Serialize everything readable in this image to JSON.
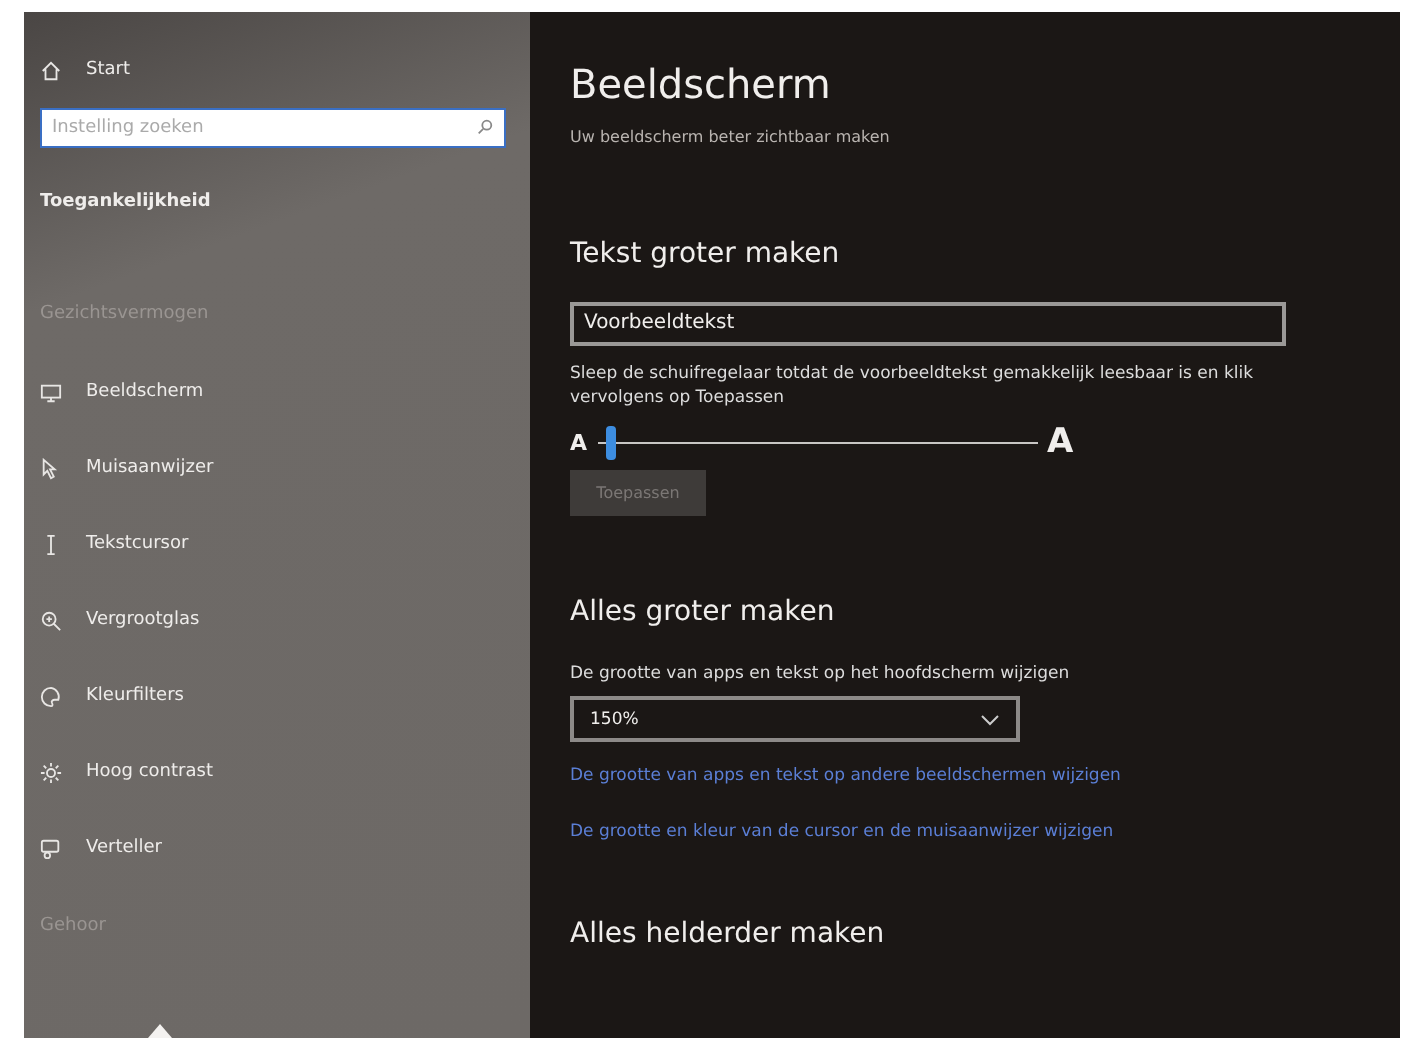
{
  "sidebar": {
    "start": "Start",
    "search": {
      "placeholder": "Instelling zoeken"
    },
    "section": "Toegankelijkheid",
    "groups": [
      {
        "heading": "Gezichtsvermogen",
        "items": [
          {
            "label": "Beeldscherm"
          },
          {
            "label": "Muisaanwijzer"
          },
          {
            "label": "Tekstcursor"
          },
          {
            "label": "Vergrootglas"
          },
          {
            "label": "Kleurfilters"
          },
          {
            "label": "Hoog contrast"
          },
          {
            "label": "Verteller"
          }
        ]
      },
      {
        "heading": "Gehoor"
      }
    ]
  },
  "page": {
    "title": "Beeldscherm",
    "subtitle": "Uw beeldscherm beter zichtbaar maken",
    "text_section": {
      "heading": "Tekst groter maken",
      "sample": "Voorbeeldtekst",
      "hint": "Sleep de schuifregelaar totdat de voorbeeldtekst gemakkelijk leesbaar is en klik vervolgens op Toepassen",
      "small_a": "A",
      "large_a": "A",
      "slider": {
        "level": 0.02
      },
      "apply": {
        "label": "Toepassen",
        "disabled": true
      }
    },
    "scale_section": {
      "heading": "Alles groter maken",
      "label": "De grootte van apps en tekst op het hoofdscherm wijzigen",
      "dropdown": "150%",
      "links": [
        "De grootte van apps en tekst op andere beeldschermen wijzigen",
        "De grootte en kleur van de cursor en de muisaanwijzer wijzigen"
      ]
    },
    "bright_section": {
      "heading": "Alles helderder maken"
    }
  }
}
